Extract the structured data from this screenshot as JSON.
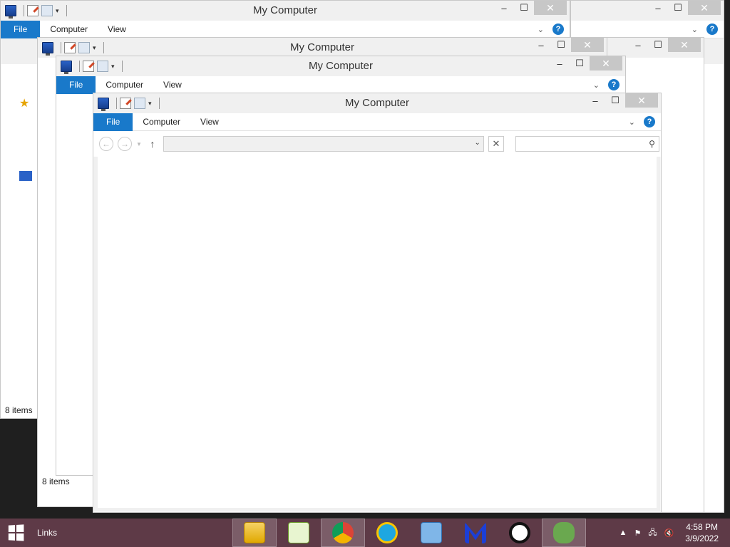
{
  "window": {
    "title": "My Computer",
    "tabs": {
      "file": "File",
      "computer": "Computer",
      "view": "View"
    },
    "status": "8 items",
    "caption": {
      "minimize": "–",
      "maximize": "☐",
      "close": "✕"
    },
    "help": "?",
    "address_value": "",
    "search_placeholder": ""
  },
  "taskbar": {
    "links_label": "Links",
    "apps": [
      "file-explorer",
      "notepad-plus-plus",
      "chrome",
      "internet-explorer",
      "control-panel",
      "malwarebytes",
      "cursor-app",
      "frog-app"
    ],
    "time": "4:58 PM",
    "date": "3/9/2022"
  },
  "colors": {
    "accent": "#1979ca",
    "taskbar": "#5e3a47"
  }
}
